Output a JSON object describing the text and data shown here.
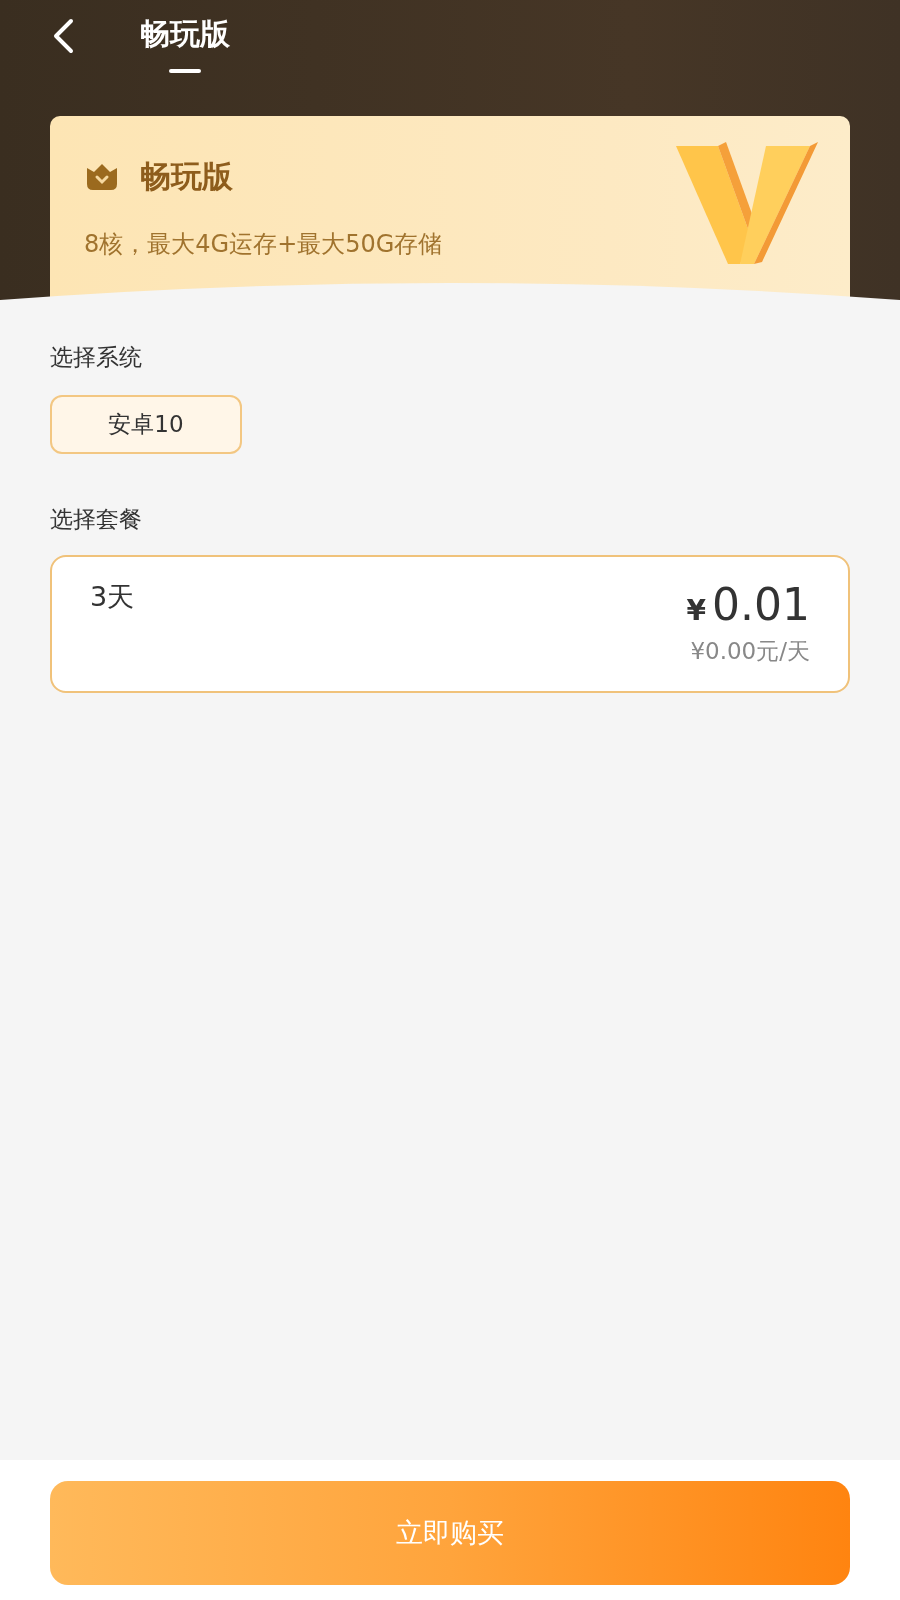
{
  "nav": {
    "tabs": [
      {
        "label": "畅玩版",
        "selected": true
      }
    ]
  },
  "plan_card": {
    "title": "畅玩版",
    "spec": "8核，最大4G运存+最大50G存储"
  },
  "system_section": {
    "label": "选择系统",
    "options": [
      {
        "label": "安卓10",
        "selected": true
      }
    ]
  },
  "package_section": {
    "label": "选择套餐",
    "options": [
      {
        "duration": "3天",
        "currency": "¥",
        "price": "0.01",
        "per_day": "¥0.00元/天",
        "selected": true
      }
    ]
  },
  "buy_button": {
    "label": "立即购买"
  }
}
